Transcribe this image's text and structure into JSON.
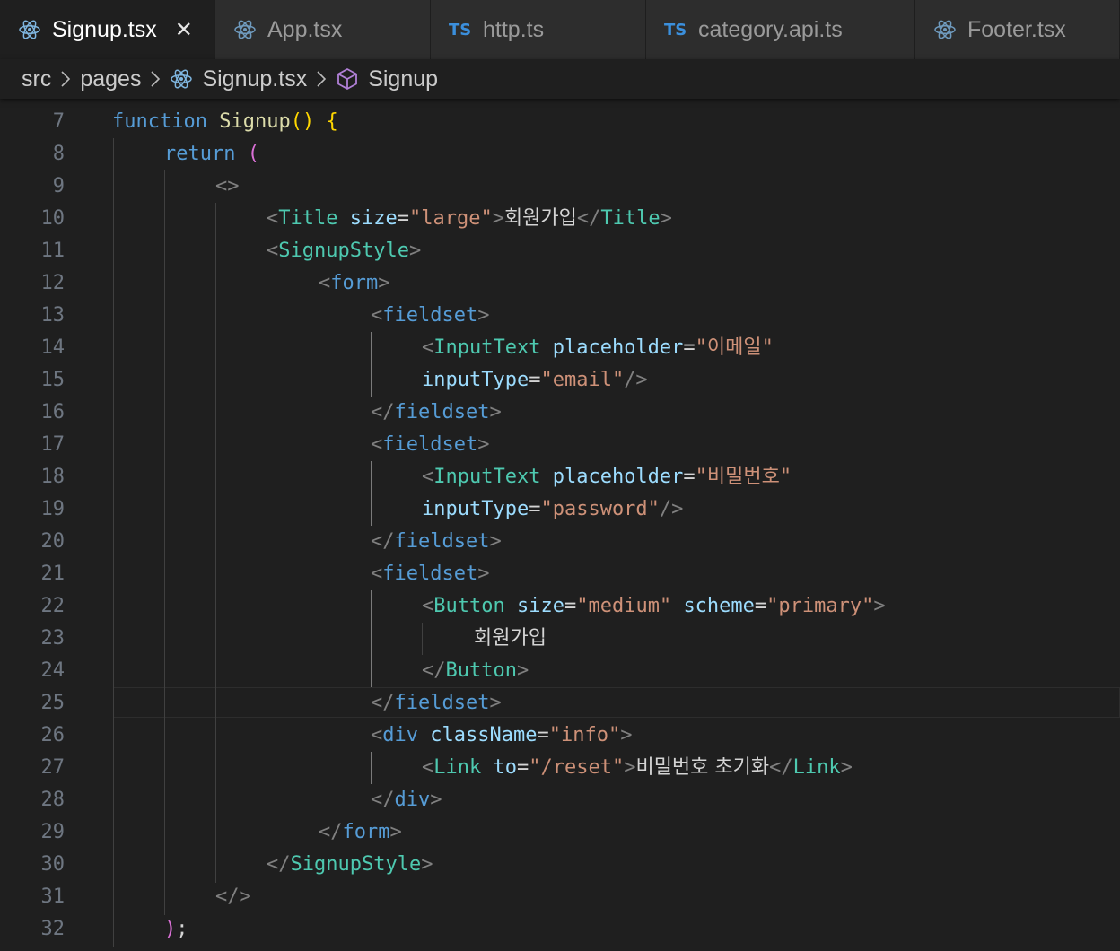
{
  "tabs": [
    {
      "label": "Signup.tsx",
      "kind": "react",
      "active": true
    },
    {
      "label": "App.tsx",
      "kind": "react",
      "active": false
    },
    {
      "label": "http.ts",
      "kind": "ts",
      "active": false
    },
    {
      "label": "category.api.ts",
      "kind": "ts",
      "active": false
    },
    {
      "label": "Footer.tsx",
      "kind": "react",
      "active": false
    }
  ],
  "ts_badge": "TS",
  "breadcrumb": {
    "items": [
      "src",
      "pages",
      "Signup.tsx",
      "Signup"
    ]
  },
  "editor": {
    "line_numbers": [
      "7",
      "8",
      "9",
      "10",
      "11",
      "12",
      "13",
      "14",
      "15",
      "16",
      "17",
      "18",
      "19",
      "20",
      "21",
      "22",
      "23",
      "24",
      "25",
      "26",
      "27",
      "28",
      "29",
      "30",
      "31",
      "32"
    ],
    "current_line": "25",
    "tokens": {
      "function_kw": "function",
      "fn_name": "Signup",
      "return_kw": "return",
      "title_tag": "Title",
      "size_attr": "size",
      "large_val": "\"large\"",
      "title_text": "회원가입",
      "signupstyle_tag": "SignupStyle",
      "form_tag": "form",
      "fieldset_tag": "fieldset",
      "inputtext_tag": "InputText",
      "placeholder_attr": "placeholder",
      "email_placeholder": "\"이메일\"",
      "inputtype_attr": "inputType",
      "email_val": "\"email\"",
      "password_placeholder": "\"비밀번호\"",
      "password_val": "\"password\"",
      "button_tag": "Button",
      "medium_val": "\"medium\"",
      "scheme_attr": "scheme",
      "primary_val": "\"primary\"",
      "button_text": "회원가입",
      "div_tag": "div",
      "classname_attr": "className",
      "info_val": "\"info\"",
      "link_tag": "Link",
      "to_attr": "to",
      "reset_val": "\"/reset\"",
      "link_text": "비밀번호 초기화"
    }
  }
}
